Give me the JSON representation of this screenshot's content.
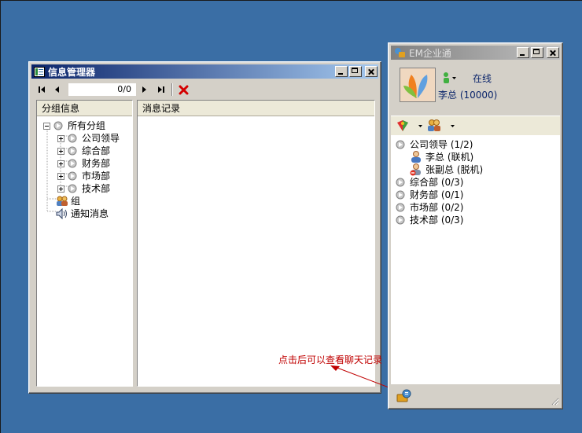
{
  "info_manager": {
    "title": "信息管理器",
    "pager": "0/0",
    "left_header": "分组信息",
    "right_header": "消息记录",
    "tree": {
      "root": "所有分组",
      "groups": [
        "公司领导",
        "综合部",
        "财务部",
        "市场部",
        "技术部"
      ],
      "group_node": "组",
      "notice_node": "通知消息"
    }
  },
  "annotation": "点击后可以查看聊天记录",
  "em": {
    "title": "EM企业通",
    "status": "在线",
    "user": "李总 (10000)",
    "contacts": {
      "leaders": "公司领导 (1/2)",
      "members": [
        {
          "name": "李总 (联机)"
        },
        {
          "name": "张副总 (脱机)"
        }
      ],
      "depts": [
        "综合部 (0/3)",
        "财务部 (0/1)",
        "市场部 (0/2)",
        "技术部 (0/3)"
      ]
    }
  }
}
